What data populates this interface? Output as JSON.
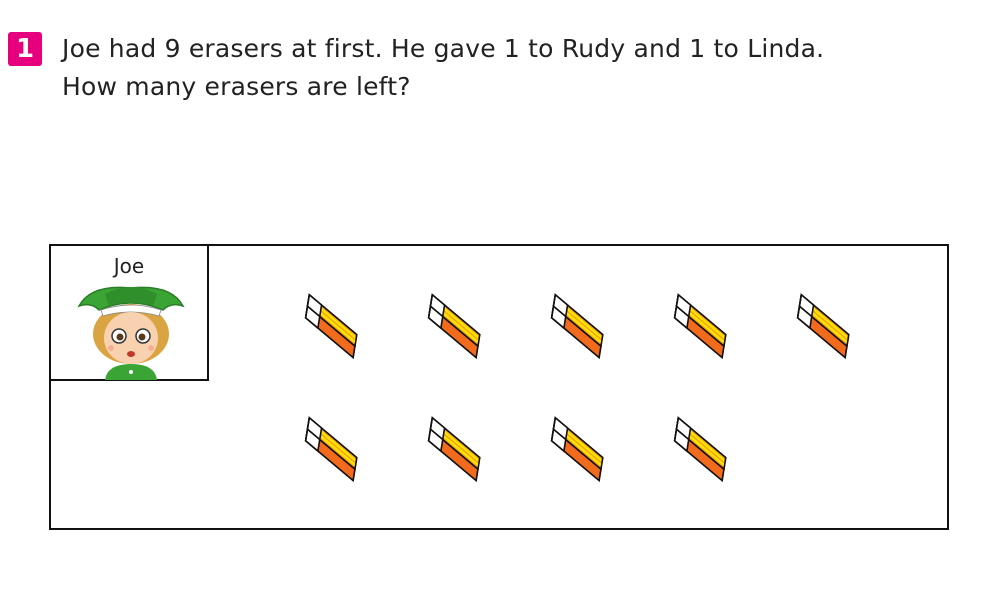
{
  "problem": {
    "number": "1",
    "line1": "Joe had 9 erasers at first. He gave 1 to Rudy and 1 to Linda.",
    "line2": "How many erasers are left?"
  },
  "character": {
    "name": "Joe"
  },
  "erasers": {
    "count": 9,
    "rows": [
      5,
      4
    ],
    "colors": {
      "side": "#f26a1b",
      "top": "#ffe600",
      "band": "#f7a21b",
      "cap": "#ffffff"
    }
  }
}
